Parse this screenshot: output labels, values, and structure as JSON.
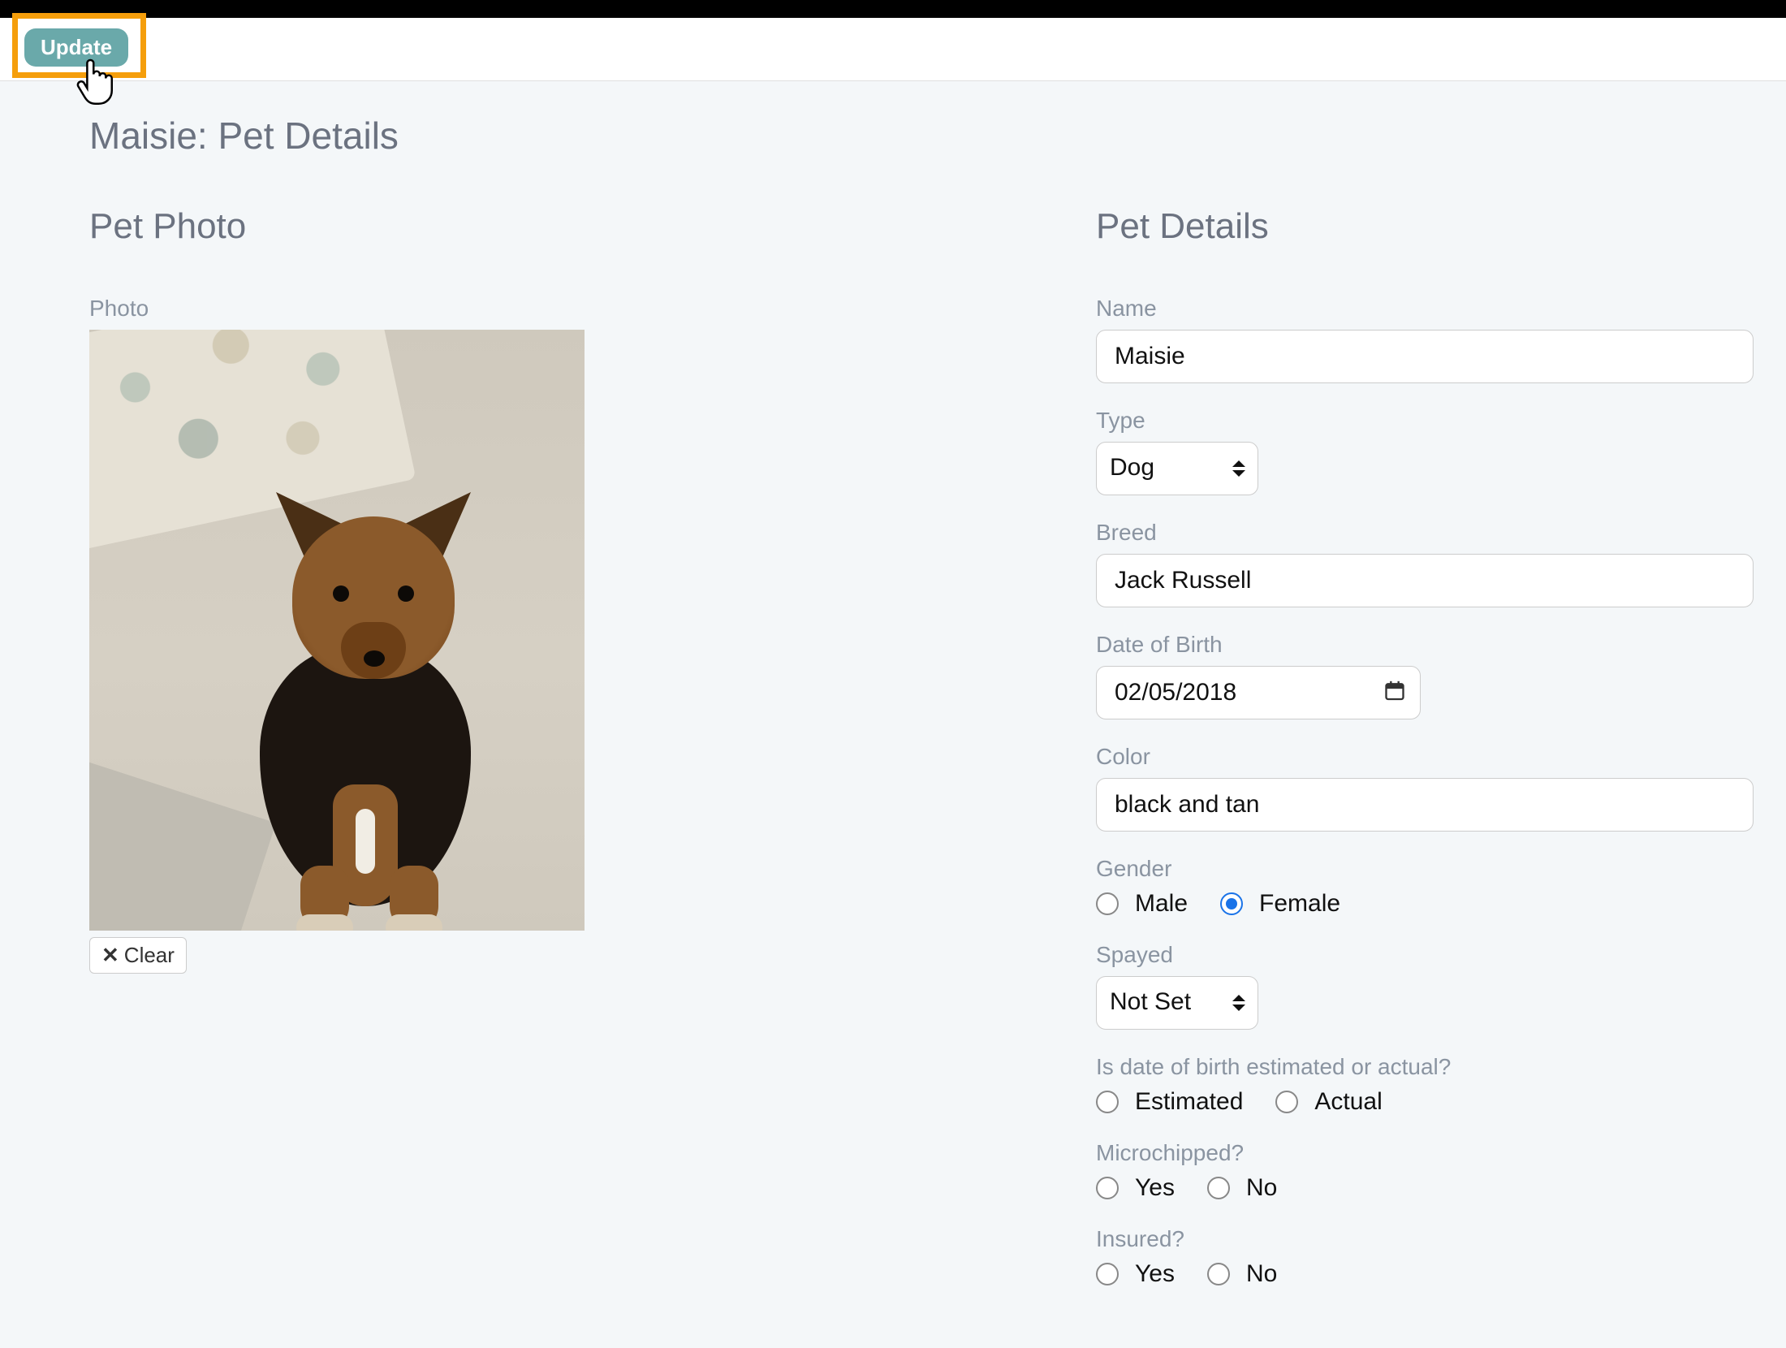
{
  "toolbar": {
    "update_label": "Update"
  },
  "page_title": "Maisie: Pet Details",
  "photo_section": {
    "heading": "Pet Photo",
    "field_label": "Photo",
    "clear_label": "Clear"
  },
  "details_section": {
    "heading": "Pet Details",
    "name": {
      "label": "Name",
      "value": "Maisie"
    },
    "type": {
      "label": "Type",
      "value": "Dog"
    },
    "breed": {
      "label": "Breed",
      "value": "Jack Russell"
    },
    "dob": {
      "label": "Date of Birth",
      "value": "02/05/2018"
    },
    "color": {
      "label": "Color",
      "value": "black and tan"
    },
    "gender": {
      "label": "Gender",
      "male": "Male",
      "female": "Female",
      "selected": "female"
    },
    "spayed": {
      "label": "Spayed",
      "value": "Not Set"
    },
    "dob_est": {
      "label": "Is date of birth estimated or actual?",
      "estimated": "Estimated",
      "actual": "Actual",
      "selected": ""
    },
    "microchipped": {
      "label": "Microchipped?",
      "yes": "Yes",
      "no": "No",
      "selected": ""
    },
    "insured": {
      "label": "Insured?",
      "yes": "Yes",
      "no": "No",
      "selected": ""
    }
  }
}
